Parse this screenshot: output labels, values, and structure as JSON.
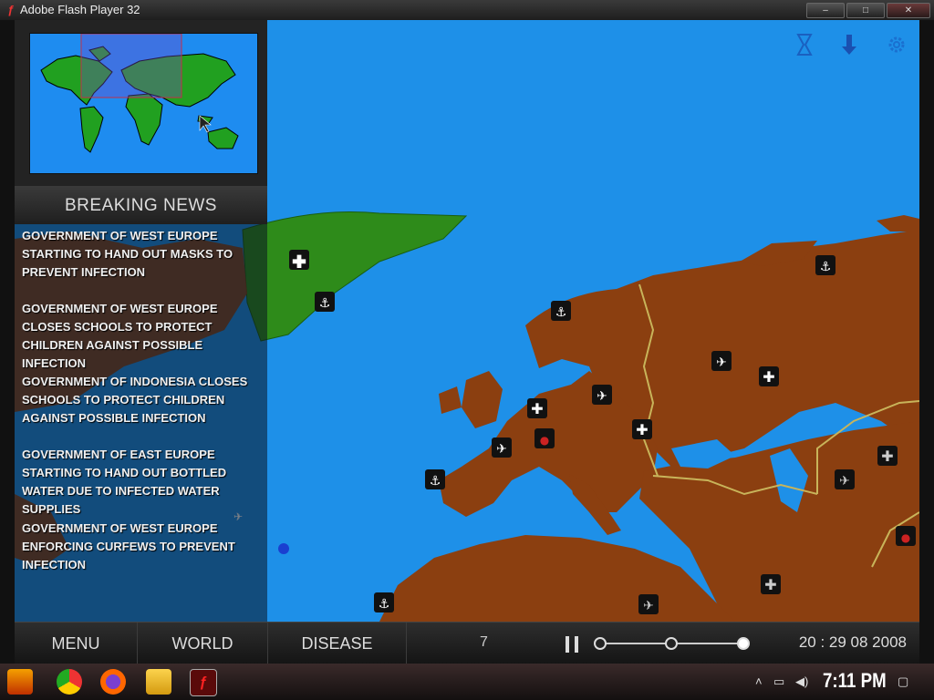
{
  "window": {
    "title": "Adobe Flash Player 32",
    "icon": "flash-icon",
    "minimize": "–",
    "maximize": "□",
    "close": "✕"
  },
  "news": {
    "header": "BREAKING NEWS",
    "items": [
      "GOVERNMENT OF WEST EUROPE STARTING TO HAND OUT MASKS TO PREVENT INFECTION",
      "GOVERNMENT OF WEST EUROPE CLOSES SCHOOLS TO PROTECT CHILDREN AGAINST POSSIBLE INFECTION",
      "GOVERNMENT OF INDONESIA CLOSES SCHOOLS TO PROTECT CHILDREN AGAINST POSSIBLE INFECTION",
      "GOVERNMENT OF EAST EUROPE STARTING TO HAND OUT BOTTLED WATER DUE TO INFECTED WATER SUPPLIES",
      "GOVERNMENT OF WEST EUROPE ENFORCING CURFEWS TO PREVENT INFECTION"
    ]
  },
  "controls": {
    "hourglass_icon": "hourglass-icon",
    "arrow_icon": "down-arrow-icon",
    "gear_icon": "gear-icon"
  },
  "bottom": {
    "menu": "MENU",
    "world": "WORLD",
    "disease": "DISEASE",
    "count": "7",
    "date": "20 : 29 08 2008",
    "speed_level": 3,
    "speed_levels": 3
  },
  "taskbar": {
    "clock": "7:11 PM",
    "apps": [
      "start-icon",
      "chrome-icon",
      "firefox-icon",
      "explorer-icon",
      "flash-icon"
    ]
  },
  "colors": {
    "ocean": "#1e90e8",
    "infected": "#8b3f10",
    "healthy": "#2e8b1a",
    "border": "#c8b45a"
  }
}
